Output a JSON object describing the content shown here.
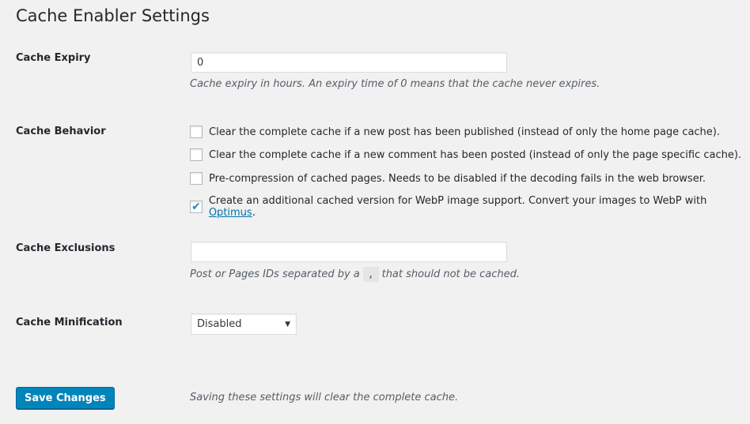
{
  "title": "Cache Enabler Settings",
  "expiry": {
    "label": "Cache Expiry",
    "value": "0",
    "desc": "Cache expiry in hours. An expiry time of 0 means that the cache never expires."
  },
  "behavior": {
    "label": "Cache Behavior",
    "options": [
      {
        "text": "Clear the complete cache if a new post has been published (instead of only the home page cache).",
        "checked": false
      },
      {
        "text": "Clear the complete cache if a new comment has been posted (instead of only the page specific cache).",
        "checked": false
      },
      {
        "text": "Pre-compression of cached pages. Needs to be disabled if the decoding fails in the web browser.",
        "checked": false
      },
      {
        "text": "Create an additional cached version for WebP image support. Convert your images to WebP with ",
        "link": "Optimus",
        "after": ".",
        "checked": true
      }
    ]
  },
  "exclusions": {
    "label": "Cache Exclusions",
    "value": "",
    "desc_before": "Post or Pages IDs separated by a",
    "code": ",",
    "desc_after": "that should not be cached."
  },
  "minification": {
    "label": "Cache Minification",
    "selected": "Disabled"
  },
  "save": {
    "label": "Save Changes",
    "note": "Saving these settings will clear the complete cache."
  }
}
